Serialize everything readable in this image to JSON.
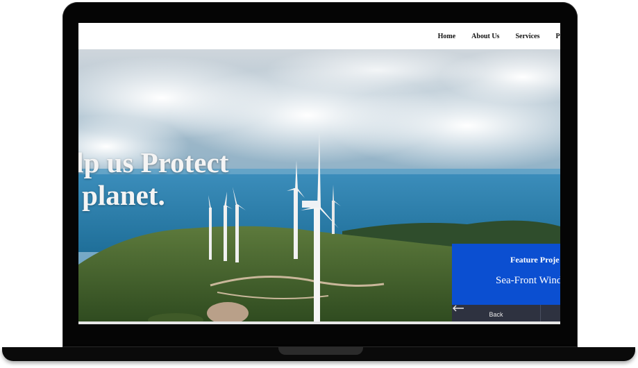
{
  "nav": {
    "items": [
      {
        "label": "Home"
      },
      {
        "label": "About Us"
      },
      {
        "label": "Services"
      },
      {
        "label": "Pr"
      }
    ]
  },
  "hero": {
    "line1": "elp us Protect",
    "line2": "ir planet."
  },
  "feature": {
    "label": "Feature Proje",
    "name": "Sea-Front Wind",
    "back_label": "Back",
    "back_icon": "arrow-left-icon",
    "accent_color": "#0b4fd1",
    "control_color": "#2e3240"
  }
}
